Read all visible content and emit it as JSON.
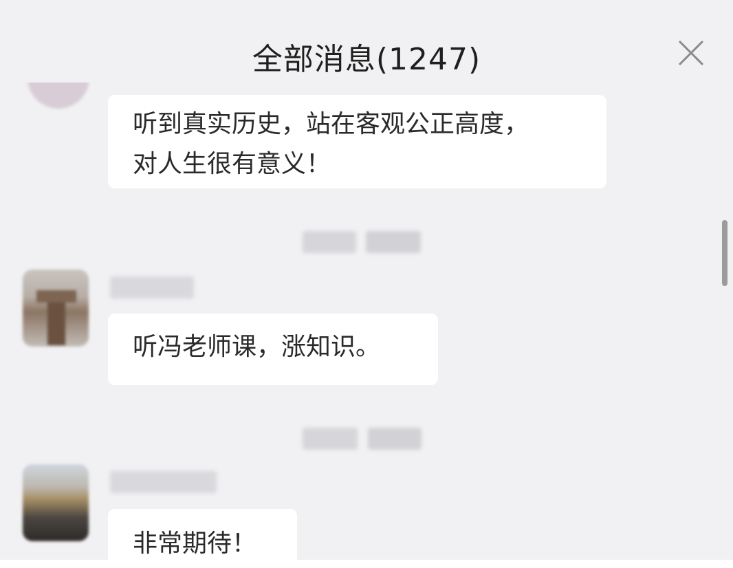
{
  "header": {
    "title": "全部消息(1247)",
    "close_icon": "close-icon"
  },
  "messages": [
    {
      "text_line1": "听到真实历史，站在客观公正高度，",
      "text_line2": "对人生很有意义！"
    },
    {
      "text": "听冯老师课，涨知识。"
    },
    {
      "text": "非常期待！"
    }
  ],
  "colors": {
    "background": "#f1f1f3",
    "bubble": "#ffffff",
    "text": "#2a2a2a",
    "scrollbar": "#9b9b9b"
  }
}
